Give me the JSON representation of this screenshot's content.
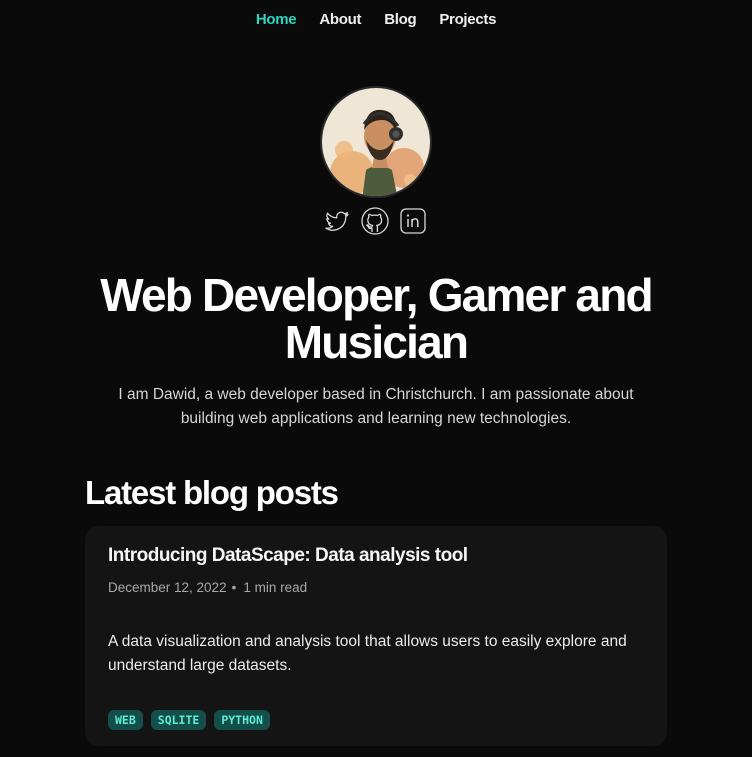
{
  "nav": {
    "items": [
      {
        "label": "Home",
        "active": true
      },
      {
        "label": "About"
      },
      {
        "label": "Blog"
      },
      {
        "label": "Projects"
      }
    ]
  },
  "profile": {
    "avatar_icon": "avatar-illustration",
    "social": [
      "twitter-icon",
      "github-icon",
      "linkedin-icon"
    ]
  },
  "hero": {
    "title": "Web Developer, Gamer and Musician",
    "description": "I am Dawid, a web developer based in Christchurch. I am passionate about building web applications and learning new technologies."
  },
  "blog": {
    "section_title": "Latest blog posts",
    "posts": [
      {
        "title": "Introducing DataScape: Data analysis tool",
        "date": "December 12, 2022",
        "separator": "•",
        "read_time": "1 min read",
        "description": "A data visualization and analysis tool that allows users to easily explore and understand large datasets.",
        "tags": [
          "WEB",
          "SQLITE",
          "PYTHON"
        ]
      }
    ]
  },
  "colors": {
    "accent": "#2dd4bf",
    "background": "#0a0a0a",
    "card": "#141414",
    "tag_bg": "#134e4a",
    "tag_text": "#5eead4"
  }
}
